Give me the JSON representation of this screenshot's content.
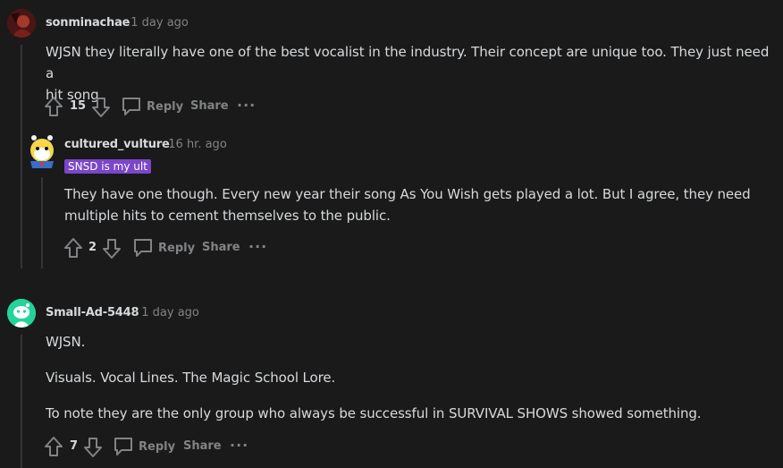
{
  "comments": [
    {
      "username": "sonminachae",
      "time": "· 1 day ago",
      "body": [
        "WJSN they literally have one of the best vocalist in the industry. Their concept are unique too. They just need a",
        "hit song"
      ],
      "votes": "15",
      "reply_label": "Reply",
      "share_label": "Share",
      "more": "···"
    },
    {
      "username": "cultured_vulture",
      "time": "· 16 hr. ago",
      "flair": "SNSD is my ult",
      "body": [
        "They have one though. Every new year their song As You Wish gets played a lot. But I agree, they need",
        "multiple hits to cement themselves to the public."
      ],
      "votes": "2",
      "reply_label": "Reply",
      "share_label": "Share",
      "more": "···"
    },
    {
      "username": "Small-Ad-5448",
      "time": "· 1 day ago",
      "body": [
        "WJSN.",
        "Visuals. Vocal Lines. The Magic School Lore.",
        "To note they are the only group who always be successful in SURVIVAL SHOWS showed something."
      ],
      "votes": "7",
      "reply_label": "Reply",
      "share_label": "Share",
      "more": "···"
    }
  ],
  "colors": {
    "background": "#1a1a1b",
    "text": "#d7dadc",
    "muted": "#818384",
    "flair_bg": "#7c46c8",
    "thread_line": "#343536"
  },
  "icons": [
    "upvote-icon",
    "downvote-icon",
    "comment-reply-icon",
    "more-options-icon"
  ]
}
